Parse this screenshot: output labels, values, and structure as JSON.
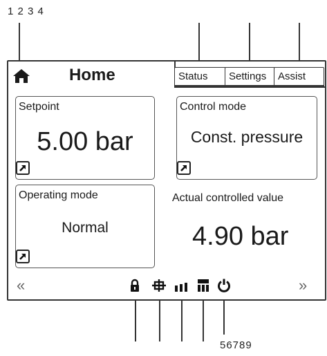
{
  "callouts": {
    "top": "1 2 3 4",
    "bottom": "56789"
  },
  "header": {
    "title": "Home",
    "home_icon": "home-icon"
  },
  "tabs": [
    {
      "label": "Status"
    },
    {
      "label": "Settings"
    },
    {
      "label": "Assist"
    }
  ],
  "tiles": {
    "setpoint": {
      "label": "Setpoint",
      "value": "5.00 bar"
    },
    "control_mode": {
      "label": "Control mode",
      "value": "Const. pressure"
    },
    "operating_mode": {
      "label": "Operating mode",
      "value": "Normal"
    },
    "actual": {
      "label": "Actual controlled value",
      "value": "4.90 bar"
    }
  },
  "navigation": {
    "prev": "«",
    "next": "»"
  },
  "status_icons": [
    "lock-icon",
    "bus-icon",
    "signal-bars-icon",
    "network-icon",
    "power-icon"
  ]
}
